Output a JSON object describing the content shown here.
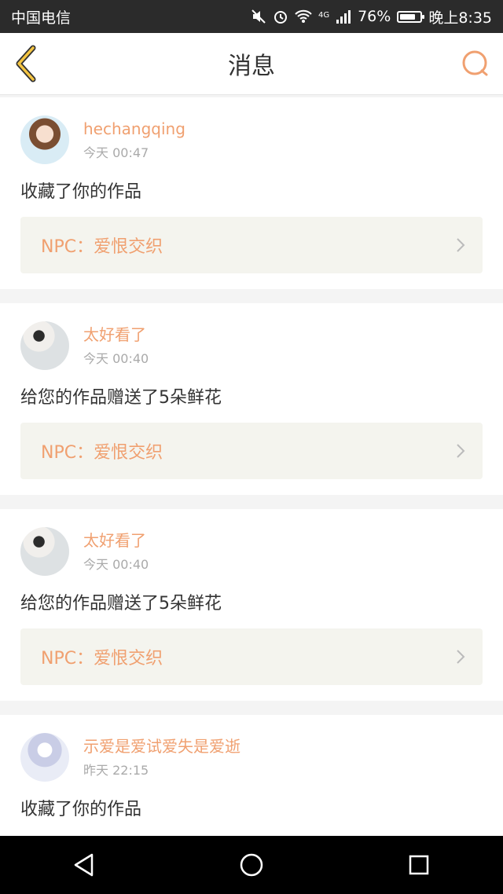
{
  "status_bar": {
    "carrier": "中国电信",
    "network": "4G",
    "battery": "76%",
    "battery_level": 0.76,
    "time": "晚上8:35"
  },
  "header": {
    "title": "消息",
    "back_icon": "back-chevron-icon",
    "search_icon": "search-icon"
  },
  "messages": [
    {
      "username": "hechangqing",
      "time": "今天 00:47",
      "action": "收藏了你的作品",
      "work_title": "NPC：爱恨交织"
    },
    {
      "username": "太好看了",
      "time": "今天 00:40",
      "action": "给您的作品赠送了5朵鲜花",
      "work_title": "NPC：爱恨交织"
    },
    {
      "username": "太好看了",
      "time": "今天 00:40",
      "action": "给您的作品赠送了5朵鲜花",
      "work_title": "NPC：爱恨交织"
    },
    {
      "username": "示爱是爱试爱失是爱逝",
      "time": "昨天 22:15",
      "action": "收藏了你的作品"
    }
  ],
  "nav": {
    "back_icon": "triangle-back-icon",
    "home_icon": "circle-home-icon",
    "recents_icon": "square-recents-icon"
  },
  "colors": {
    "accent": "#f0a070",
    "link_bg": "#f4f4ee",
    "status_bar": "#2b2b2b"
  }
}
